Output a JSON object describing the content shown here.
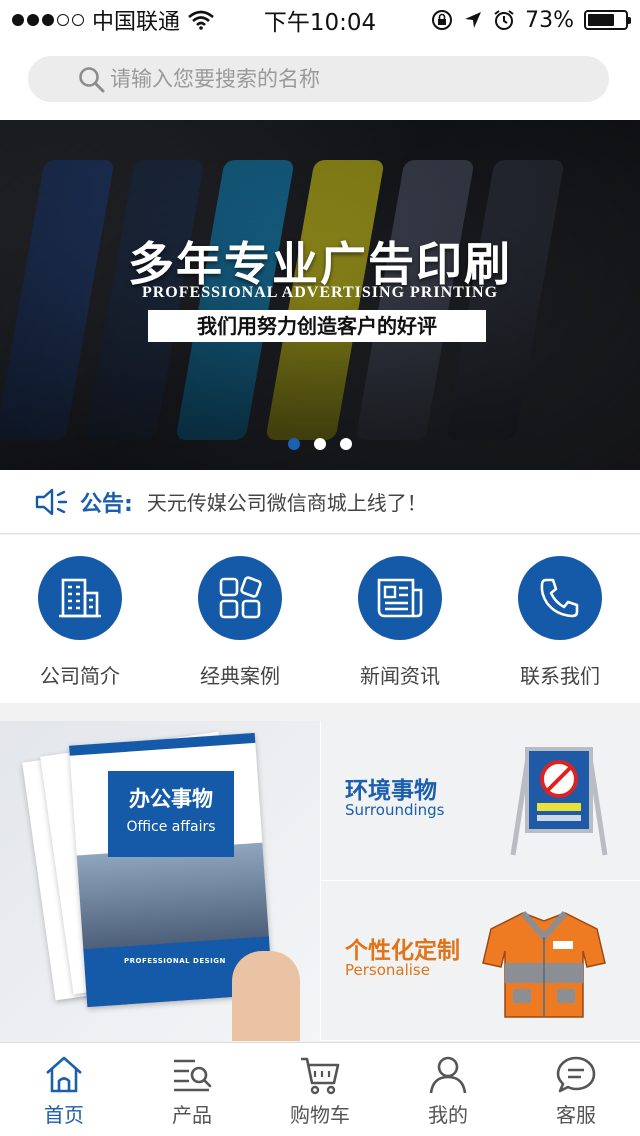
{
  "status_bar": {
    "carrier": "中国联通",
    "time": "下午10:04",
    "battery": "73%",
    "battery_level": 0.73
  },
  "search": {
    "placeholder": "请输入您要搜索的名称",
    "icon": "search-icon"
  },
  "banner": {
    "title": "多年专业广告印刷",
    "subtitle": "PROFESSIONAL ADVERTISING PRINTING",
    "tagline": "我们用努力创造客户的好评",
    "slide_count": 3,
    "active_slide": 1
  },
  "notice": {
    "label": "公告:",
    "text": "天元传媒公司微信商城上线了！",
    "icon": "speaker-icon"
  },
  "quick_nav": [
    {
      "label": "公司简介",
      "icon": "building-icon"
    },
    {
      "label": "经典案例",
      "icon": "grid-icon"
    },
    {
      "label": "新闻资讯",
      "icon": "news-icon"
    },
    {
      "label": "联系我们",
      "icon": "phone-icon"
    }
  ],
  "categories": {
    "office": {
      "title": "办公事物",
      "subtitle": "Office affairs",
      "cover_text": "PROFESSIONAL DESIGN"
    },
    "surroundings": {
      "title": "环境事物",
      "subtitle": "Surroundings"
    },
    "personalise": {
      "title": "个性化定制",
      "subtitle": "Personalise"
    }
  },
  "tab_bar": [
    {
      "label": "首页",
      "icon": "home-icon",
      "active": true
    },
    {
      "label": "产品",
      "icon": "product-list-icon",
      "active": false
    },
    {
      "label": "购物车",
      "icon": "cart-icon",
      "active": false
    },
    {
      "label": "我的",
      "icon": "user-icon",
      "active": false
    },
    {
      "label": "客服",
      "icon": "chat-icon",
      "active": false
    }
  ],
  "colors": {
    "brand_blue": "#155aa8",
    "accent_orange": "#e07418"
  }
}
